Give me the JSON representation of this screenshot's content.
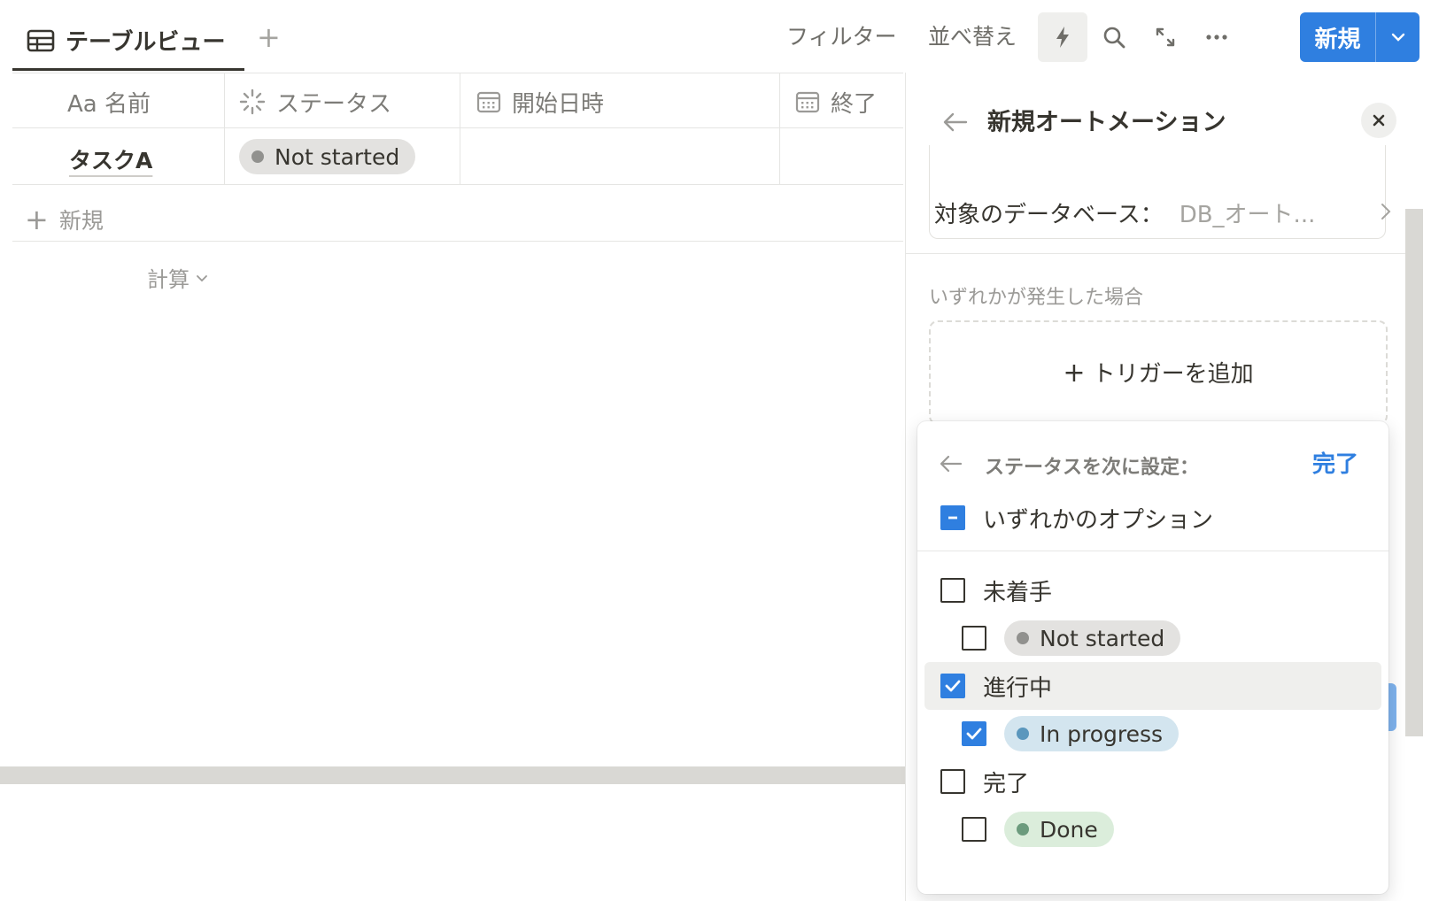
{
  "toolbar": {
    "view_tab_label": "テーブルビュー",
    "add_view": "+",
    "filter_label": "フィルター",
    "sort_label": "並べ替え",
    "new_button_label": "新規"
  },
  "table": {
    "columns": [
      {
        "icon": "text-property-icon",
        "label": "Aa 名前"
      },
      {
        "icon": "status-property-icon",
        "label": "ステータス"
      },
      {
        "icon": "calendar-icon",
        "label": "開始日時"
      },
      {
        "icon": "calendar-icon",
        "label": "終了"
      }
    ],
    "rows": [
      {
        "name": "タスクA",
        "status": "Not started",
        "status_color": "#91918e",
        "status_bg": "#e3e2e0"
      }
    ],
    "new_row_label": "新規",
    "calc_label": "計算"
  },
  "panel": {
    "title": "新規オートメーション",
    "db_label": "対象のデータベース：",
    "db_value": "DB_オート...",
    "when_label": "いずれかが発生した場合",
    "add_trigger_label": "トリガーを追加"
  },
  "dropdown": {
    "title": "ステータスを次に設定：",
    "done_label": "完了",
    "any_option_label": "いずれかのオプション",
    "groups": [
      {
        "label": "未着手",
        "checked": false,
        "option": "Not started",
        "dot": "#91918e",
        "bg": "#e3e2e0",
        "option_checked": false
      },
      {
        "label": "進行中",
        "checked": true,
        "option": "In progress",
        "dot": "#5b97bd",
        "bg": "#d3e5ef",
        "option_checked": true
      },
      {
        "label": "完了",
        "checked": false,
        "option": "Done",
        "dot": "#6c9b7d",
        "bg": "#dbeddb",
        "option_checked": false
      }
    ]
  },
  "colors": {
    "accent": "#2f7fe0",
    "text": "#37352f",
    "muted": "#9b9a97"
  }
}
